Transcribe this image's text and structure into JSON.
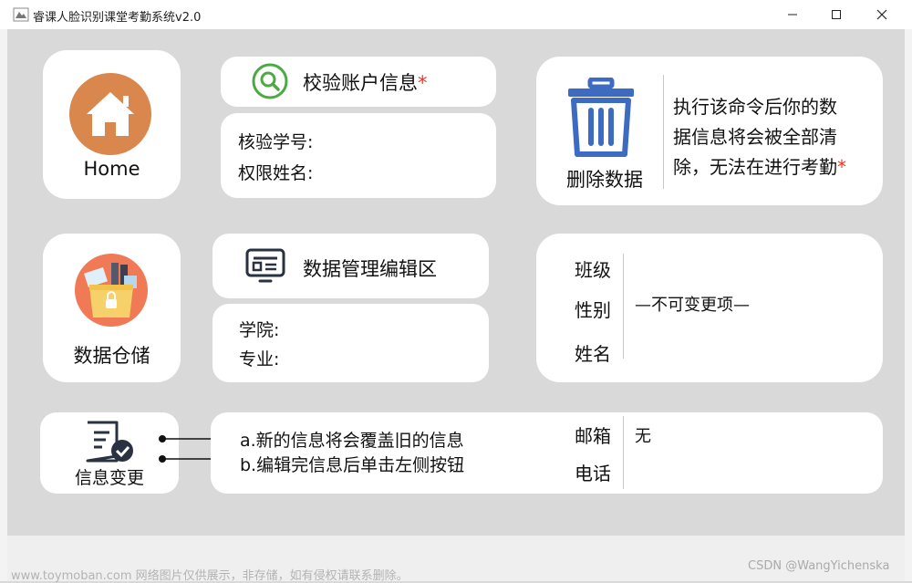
{
  "window": {
    "title": "睿课人脸识别课堂考勤系统v2.0",
    "minimize": "—",
    "maximize": "☐",
    "close": "✕"
  },
  "home": {
    "label": "Home",
    "icon": "home-icon"
  },
  "verify": {
    "title": "校验账户信息",
    "required_mark": "*",
    "id_label": "核验学号:",
    "name_label": "权限姓名:",
    "icon": "search-icon"
  },
  "delete": {
    "label": "删除数据",
    "icon": "trash-icon",
    "warning_lines": [
      "执行该命令后你的数",
      "据信息将会被全部清",
      "除，无法在进行考勤"
    ],
    "required_mark": "*"
  },
  "warehouse": {
    "label": "数据仓储",
    "icon": "warehouse-icon"
  },
  "edit_zone": {
    "title": "数据管理编辑区",
    "icon": "dashboard-icon",
    "college_label": "学院:",
    "major_label": "专业:"
  },
  "fixed_info": {
    "class_label": "班级",
    "gender_label": "性别",
    "name_label": "姓名",
    "immutable_note": "—不可变更项—"
  },
  "change": {
    "label": "信息变更",
    "icon": "document-check-icon",
    "note_a": "a.新的信息将会覆盖旧的信息",
    "note_b": "b.编辑完信息后单击左侧按钮"
  },
  "contact": {
    "email_label": "邮箱",
    "email_value": "无",
    "phone_label": "电话"
  },
  "watermarks": {
    "left": "www.toymoban.com 网络图片仅供展示，非存储，如有侵权请联系删除。",
    "right": "CSDN @WangYichenska"
  },
  "colors": {
    "home_circle": "#d9874c",
    "search_green": "#4caa44",
    "trash_blue": "#3d6bc2",
    "star": "#e33322"
  }
}
